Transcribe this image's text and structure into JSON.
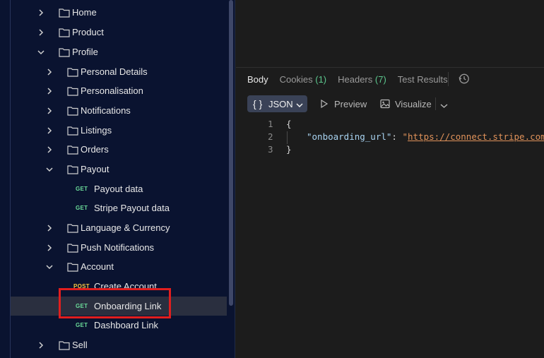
{
  "sidebar": {
    "items": [
      {
        "type": "folder",
        "label": "Home",
        "expanded": false
      },
      {
        "type": "folder",
        "label": "Product",
        "expanded": false
      },
      {
        "type": "folder",
        "label": "Profile",
        "expanded": true
      },
      {
        "type": "folder",
        "label": "Personal Details",
        "expanded": false
      },
      {
        "type": "folder",
        "label": "Personalisation",
        "expanded": false
      },
      {
        "type": "folder",
        "label": "Notifications",
        "expanded": false
      },
      {
        "type": "folder",
        "label": "Listings",
        "expanded": false
      },
      {
        "type": "folder",
        "label": "Orders",
        "expanded": false
      },
      {
        "type": "folder",
        "label": "Payout",
        "expanded": true
      },
      {
        "type": "request",
        "method": "GET",
        "label": "Payout data"
      },
      {
        "type": "request",
        "method": "GET",
        "label": "Stripe Payout data"
      },
      {
        "type": "folder",
        "label": "Language & Currency",
        "expanded": false
      },
      {
        "type": "folder",
        "label": "Push Notifications",
        "expanded": false
      },
      {
        "type": "folder",
        "label": "Account",
        "expanded": true
      },
      {
        "type": "request",
        "method": "POST",
        "label": "Create Account"
      },
      {
        "type": "request",
        "method": "GET",
        "label": "Onboarding Link",
        "selected": true
      },
      {
        "type": "request",
        "method": "GET",
        "label": "Dashboard Link"
      },
      {
        "type": "folder",
        "label": "Sell",
        "expanded": false
      }
    ]
  },
  "response": {
    "tabs": [
      {
        "label": "Body",
        "count": "",
        "active": true
      },
      {
        "label": "Cookies",
        "count": "(1)",
        "active": false
      },
      {
        "label": "Headers",
        "count": "(7)",
        "active": false
      },
      {
        "label": "Test Results",
        "count": "",
        "active": false
      }
    ],
    "format_label": "JSON",
    "format_braces": "{ }",
    "preview_label": "Preview",
    "visualize_label": "Visualize",
    "code": {
      "line_numbers": [
        "1",
        "2",
        "3"
      ],
      "open_brace": "{",
      "key": "\"onboarding_url\"",
      "colon": ": ",
      "value_quote": "\"",
      "value": "https://connect.stripe.com/se",
      "close_brace": "}"
    }
  },
  "colors": {
    "sidebar_bg": "#0a1330",
    "get_method": "#6bdd9a",
    "post_method": "#f6c543",
    "count_green": "#5cc78e",
    "highlight_red": "#e01e1e",
    "url_orange": "#e0925a"
  }
}
